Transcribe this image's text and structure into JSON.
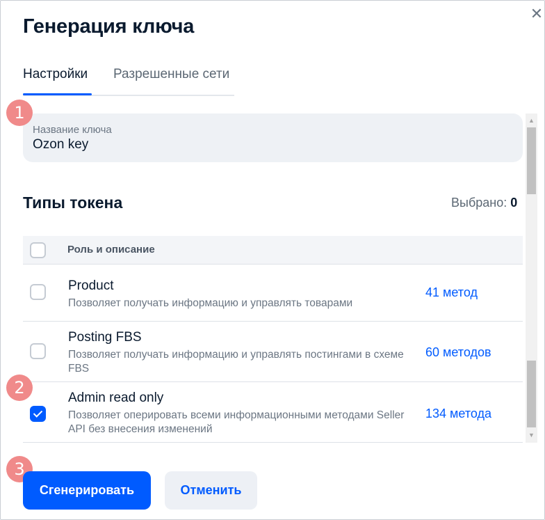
{
  "dialog": {
    "title": "Генерация ключа",
    "close_glyph": "✕"
  },
  "tabs": [
    {
      "label": "Настройки",
      "active": true
    },
    {
      "label": "Разрешенные сети",
      "active": false
    }
  ],
  "badges": [
    "1",
    "2",
    "3"
  ],
  "key_name": {
    "label": "Название ключа",
    "value": "Ozon key"
  },
  "token_types": {
    "title": "Типы токена",
    "selected_label": "Выбрано:",
    "selected_count": "0",
    "header": "Роль и описание",
    "rows": [
      {
        "name": "Product",
        "description": "Позволяет получать информацию и управлять товарами",
        "methods": "41 метод",
        "checked": false
      },
      {
        "name": "Posting FBS",
        "description": "Позволяет получать информацию и управлять постингами в схеме FBS",
        "methods": "60 методов",
        "checked": false
      },
      {
        "name": "Admin read only",
        "description": "Позволяет оперировать всеми информационными методами Seller API без внесения изменений",
        "methods": "134 метода",
        "checked": true
      }
    ]
  },
  "scrollbar": {
    "position_fraction": 0.8
  },
  "buttons": {
    "generate": "Сгенерировать",
    "cancel": "Отменить"
  },
  "colors": {
    "accent": "#005bff",
    "badge": "#f08a8a"
  },
  "icons": {
    "close": "close-icon",
    "check": "check-icon",
    "scroll_up": "arrow-up-icon",
    "scroll_down": "arrow-down-icon"
  }
}
